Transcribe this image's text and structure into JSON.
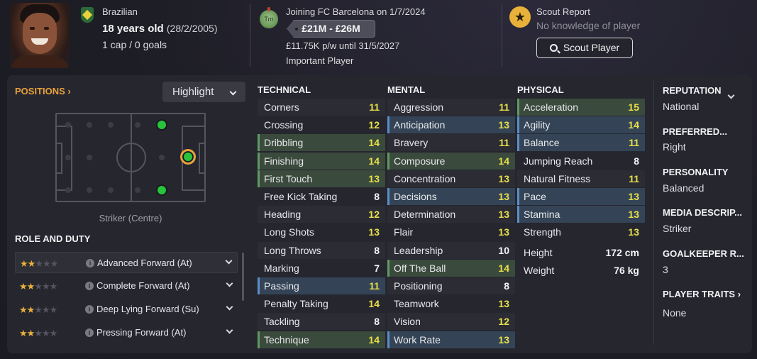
{
  "header": {
    "nationality": "Brazilian",
    "age": "18 years old",
    "dob": "(28/2/2005)",
    "caps": "1 cap / 0 goals",
    "transfer": {
      "joining": "Joining FC Barcelona on 1/7/2024",
      "club_badge_text": "Trn",
      "fee": "£21M - £26M",
      "wage": "£11.75K p/w until 31/5/2027",
      "importance": "Important Player"
    },
    "scout": {
      "title": "Scout Report",
      "subtitle": "No knowledge of player",
      "button_label": "Scout Player"
    }
  },
  "positions": {
    "link": "POSITIONS ›",
    "highlight_label": "Highlight",
    "position_label": "Striker (Centre)"
  },
  "roles": {
    "title": "ROLE AND DUTY",
    "items": [
      {
        "name": "Advanced Forward (At)",
        "stars": 2
      },
      {
        "name": "Complete Forward (At)",
        "stars": 2
      },
      {
        "name": "Deep Lying Forward (Su)",
        "stars": 2
      },
      {
        "name": "Pressing Forward (At)",
        "stars": 2
      }
    ]
  },
  "attributes": {
    "technical_title": "TECHNICAL",
    "mental_title": "MENTAL",
    "physical_title": "PHYSICAL",
    "technical": [
      {
        "name": "Corners",
        "value": "11",
        "hl": ""
      },
      {
        "name": "Crossing",
        "value": "12",
        "hl": ""
      },
      {
        "name": "Dribbling",
        "value": "14",
        "hl": "green"
      },
      {
        "name": "Finishing",
        "value": "14",
        "hl": "green"
      },
      {
        "name": "First Touch",
        "value": "13",
        "hl": "green"
      },
      {
        "name": "Free Kick Taking",
        "value": "8",
        "hl": ""
      },
      {
        "name": "Heading",
        "value": "12",
        "hl": ""
      },
      {
        "name": "Long Shots",
        "value": "13",
        "hl": ""
      },
      {
        "name": "Long Throws",
        "value": "8",
        "hl": ""
      },
      {
        "name": "Marking",
        "value": "7",
        "hl": ""
      },
      {
        "name": "Passing",
        "value": "11",
        "hl": "blue"
      },
      {
        "name": "Penalty Taking",
        "value": "14",
        "hl": ""
      },
      {
        "name": "Tackling",
        "value": "8",
        "hl": ""
      },
      {
        "name": "Technique",
        "value": "14",
        "hl": "green"
      }
    ],
    "mental": [
      {
        "name": "Aggression",
        "value": "11",
        "hl": ""
      },
      {
        "name": "Anticipation",
        "value": "13",
        "hl": "blue"
      },
      {
        "name": "Bravery",
        "value": "11",
        "hl": ""
      },
      {
        "name": "Composure",
        "value": "14",
        "hl": "green"
      },
      {
        "name": "Concentration",
        "value": "13",
        "hl": ""
      },
      {
        "name": "Decisions",
        "value": "13",
        "hl": "blue"
      },
      {
        "name": "Determination",
        "value": "13",
        "hl": ""
      },
      {
        "name": "Flair",
        "value": "13",
        "hl": ""
      },
      {
        "name": "Leadership",
        "value": "10",
        "hl": ""
      },
      {
        "name": "Off The Ball",
        "value": "14",
        "hl": "green"
      },
      {
        "name": "Positioning",
        "value": "8",
        "hl": ""
      },
      {
        "name": "Teamwork",
        "value": "13",
        "hl": ""
      },
      {
        "name": "Vision",
        "value": "12",
        "hl": ""
      },
      {
        "name": "Work Rate",
        "value": "13",
        "hl": "blue"
      }
    ],
    "physical": [
      {
        "name": "Acceleration",
        "value": "15",
        "hl": "green"
      },
      {
        "name": "Agility",
        "value": "14",
        "hl": "blue"
      },
      {
        "name": "Balance",
        "value": "11",
        "hl": "blue"
      },
      {
        "name": "Jumping Reach",
        "value": "8",
        "hl": ""
      },
      {
        "name": "Natural Fitness",
        "value": "11",
        "hl": ""
      },
      {
        "name": "Pace",
        "value": "13",
        "hl": "blue"
      },
      {
        "name": "Stamina",
        "value": "13",
        "hl": "blue"
      },
      {
        "name": "Strength",
        "value": "13",
        "hl": ""
      }
    ],
    "height_label": "Height",
    "height_value": "172 cm",
    "weight_label": "Weight",
    "weight_value": "76 kg"
  },
  "info": {
    "reputation_label": "REPUTATION",
    "reputation_value": "National",
    "preferred_label": "PREFERRED...",
    "preferred_value": "Right",
    "personality_label": "PERSONALITY",
    "personality_value": "Balanced",
    "media_label": "MEDIA DESCRIP...",
    "media_value": "Striker",
    "gk_label": "GOALKEEPER R...",
    "gk_value": "3",
    "traits_label": "PLAYER TRAITS ›",
    "traits_value": "None"
  },
  "colors": {
    "accent_orange": "#e8a23c",
    "value_yellow": "#e8e04a",
    "highlight_green": "#3a4a3c",
    "highlight_blue": "#344456",
    "position_green": "#27c43c"
  }
}
